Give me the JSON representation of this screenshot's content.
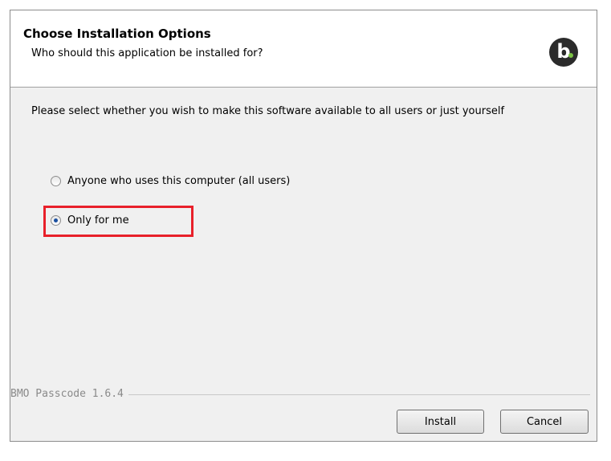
{
  "header": {
    "title": "Choose Installation Options",
    "subtitle": "Who should this application be installed for?"
  },
  "logo": {
    "letter": "b",
    "bg_color": "#2b2b2b",
    "dot_color": "#7ac143"
  },
  "description": "Please select whether you wish to make this software available to all users or just yourself",
  "options": [
    {
      "label": "Anyone who uses this computer (all users)",
      "checked": false
    },
    {
      "label": "Only for me",
      "checked": true
    }
  ],
  "highlight_color": "#e8202a",
  "branding": "BMO Passcode 1.6.4",
  "buttons": {
    "install": "Install",
    "cancel": "Cancel"
  }
}
